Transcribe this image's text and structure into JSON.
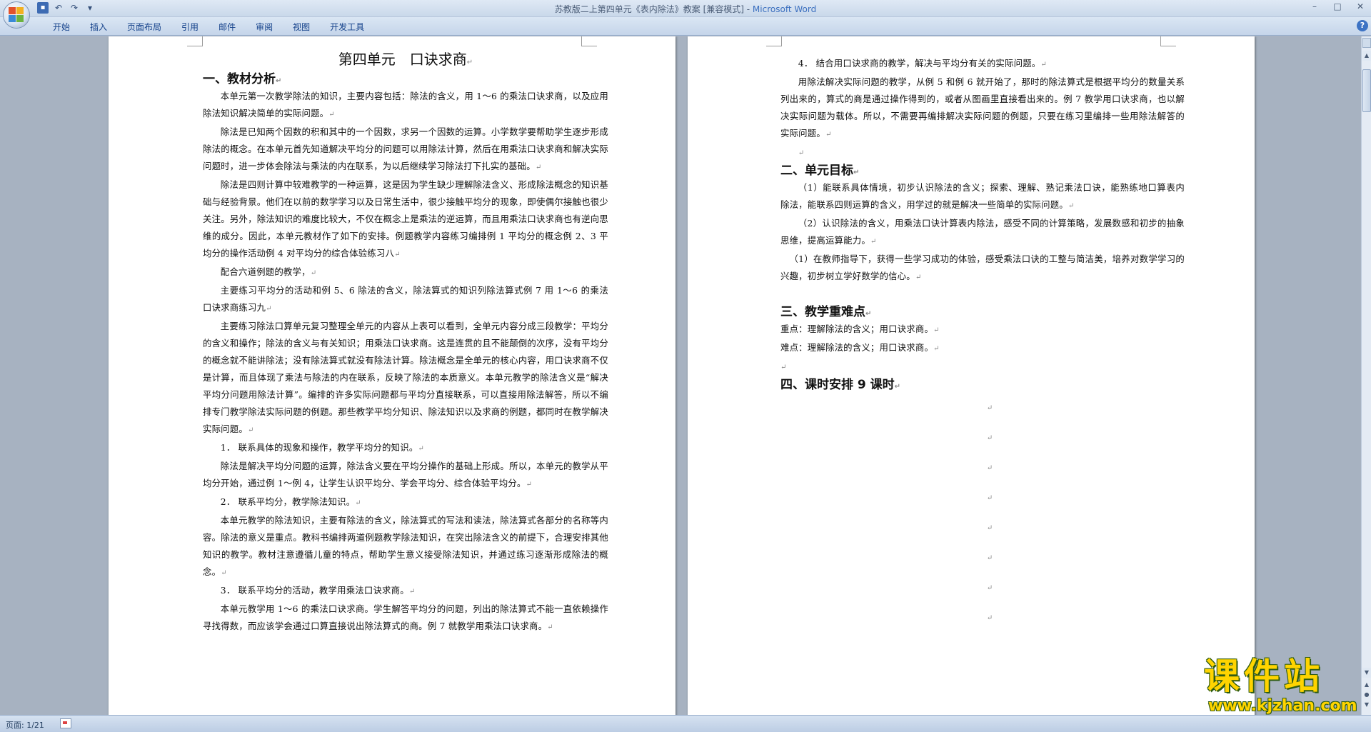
{
  "window": {
    "title_doc": "苏教版二上第四单元《表内除法》教案 [兼容模式] - ",
    "title_app": "Microsoft Word",
    "controls": [
      "–",
      "□",
      "✕"
    ]
  },
  "quick_access": {
    "icons": [
      "save-icon",
      "undo-icon",
      "redo-icon",
      "customize-icon"
    ]
  },
  "ribbon": {
    "tabs": [
      "开始",
      "插入",
      "页面布局",
      "引用",
      "邮件",
      "审阅",
      "视图",
      "开发工具"
    ]
  },
  "page1": {
    "title": "第四单元　口诀求商",
    "h1": "一、教材分析",
    "paragraphs": [
      "本单元第一次教学除法的知识，主要内容包括：除法的含义，用 1～6 的乘法口诀求商，以及应用除法知识解决简单的实际问题。",
      "除法是已知两个因数的积和其中的一个因数，求另一个因数的运算。小学数学要帮助学生逐步形成除法的概念。在本单元首先知道解决平均分的问题可以用除法计算，然后在用乘法口诀求商和解决实际问题时，进一步体会除法与乘法的内在联系，为以后继续学习除法打下扎实的基础。",
      "除法是四则计算中较难教学的一种运算，这是因为学生缺少理解除法含义、形成除法概念的知识基础与经验背景。他们在以前的数学学习以及日常生活中，很少接触平均分的现象，即使偶尔接触也很少关注。另外，除法知识的难度比较大，不仅在概念上是乘法的逆运算，而且用乘法口诀求商也有逆向思维的成分。因此，本单元教材作了如下的安排。例题教学内容练习编排例 1 平均分的概念例 2、3 平均分的操作活动例 4 对平均分的综合体验练习八",
      "配合六道例题的教学，",
      "主要练习平均分的活动和例 5、6 除法的含义，除法算式的知识列除法算式例 7 用 1～6 的乘法口诀求商练习九",
      "主要练习除法口算单元复习整理全单元的内容从上表可以看到，全单元内容分成三段教学：平均分的含义和操作；除法的含义与有关知识；用乘法口诀求商。这是连贯的且不能颠倒的次序，没有平均分的概念就不能讲除法；没有除法算式就没有除法计算。除法概念是全单元的核心内容，用口诀求商不仅是计算，而且体现了乘法与除法的内在联系，反映了除法的本质意义。本单元教学的除法含义是“解决平均分问题用除法计算”。编排的许多实际问题都与平均分直接联系，可以直接用除法解答，所以不编排专门教学除法实际问题的例题。那些教学平均分知识、除法知识以及求商的例题，都同时在教学解决实际问题。",
      "1． 联系具体的现象和操作，教学平均分的知识。",
      "除法是解决平均分问题的运算，除法含义要在平均分操作的基础上形成。所以，本单元的教学从平均分开始，通过例 1～例 4，让学生认识平均分、学会平均分、综合体验平均分。",
      "2． 联系平均分，教学除法知识。",
      "本单元教学的除法知识，主要有除法的含义，除法算式的写法和读法，除法算式各部分的名称等内容。除法的意义是重点。教科书编排两道例题教学除法知识，在突出除法含义的前提下，合理安排其他知识的教学。教材注意遵循儿童的特点，帮助学生意义接受除法知识，并通过练习逐渐形成除法的概念。",
      "3． 联系平均分的活动，教学用乘法口诀求商。",
      "本单元教学用 1～6 的乘法口诀求商。学生解答平均分的问题，列出的除法算式不能一直依赖操作寻找得数，而应该学会通过口算直接说出除法算式的商。例 7 就教学用乘法口诀求商。"
    ]
  },
  "page2": {
    "paragraphs_top": [
      "4． 结合用口诀求商的教学，解决与平均分有关的实际问题。",
      "用除法解决实际问题的教学，从例 5 和例 6 就开始了，那时的除法算式是根据平均分的数量关系列出来的，算式的商是通过操作得到的，或者从图画里直接看出来的。例 7 教学用口诀求商，也以解决实际问题为载体。所以，不需要再编排解决实际问题的例题，只要在练习里编排一些用除法解答的实际问题。"
    ],
    "h2": "二、单元目标",
    "goals": [
      "（1）能联系具体情境，初步认识除法的含义；探索、理解、熟记乘法口诀，能熟练地口算表内　　除法，能联系四则运算的含义，用学过的就是解决一些简单的实际问题。",
      "（2）认识除法的含义，用乘法口诀计算表内除法，感受不同的计算策略，发展数感和初步的抽象思维，提高运算能力。",
      "（1）在教师指导下，获得一些学习成功的体验，感受乘法口诀的工整与简洁美，培养对数学学习的兴趣，初步树立学好数学的信心。"
    ],
    "h3": "三、教学重难点",
    "key_points": [
      "重点：理解除法的含义；用口诀求商。",
      "难点：理解除法的含义；用口诀求商。"
    ],
    "h4": "四、课时安排 9 课时"
  },
  "paragraph_mark": "↵",
  "statusbar": {
    "page": "页面: 1/21"
  },
  "watermark": {
    "main": "课件站",
    "url": "www.kjzhan.com"
  }
}
